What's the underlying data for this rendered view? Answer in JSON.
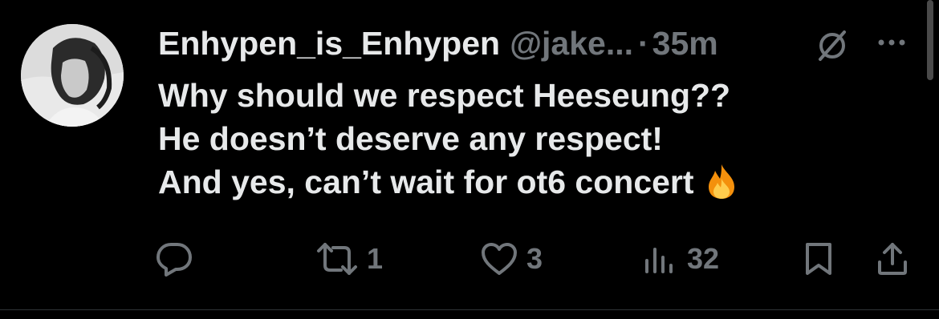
{
  "tweet": {
    "author": {
      "display_name": "Enhypen_is_Enhypen",
      "handle": "@jake...",
      "avatar_icon": "profile-photo"
    },
    "separator": "·",
    "time": "35m",
    "text_lines": [
      "Why should we respect Heeseung??",
      "He doesn’t deserve any respect!",
      "And yes, can’t wait for ot6 concert"
    ],
    "emoji": "fire-emoji",
    "actions": {
      "reply": {
        "icon": "reply-icon",
        "count": ""
      },
      "repost": {
        "icon": "repost-icon",
        "count": "1"
      },
      "like": {
        "icon": "heart-icon",
        "count": "3"
      },
      "views": {
        "icon": "views-icon",
        "count": "32"
      },
      "bookmark": {
        "icon": "bookmark-icon"
      },
      "share": {
        "icon": "share-icon"
      }
    }
  },
  "colors": {
    "background": "#000000",
    "text_primary": "#e7e9ea",
    "text_secondary": "#71767b",
    "divider": "#2f3336"
  }
}
